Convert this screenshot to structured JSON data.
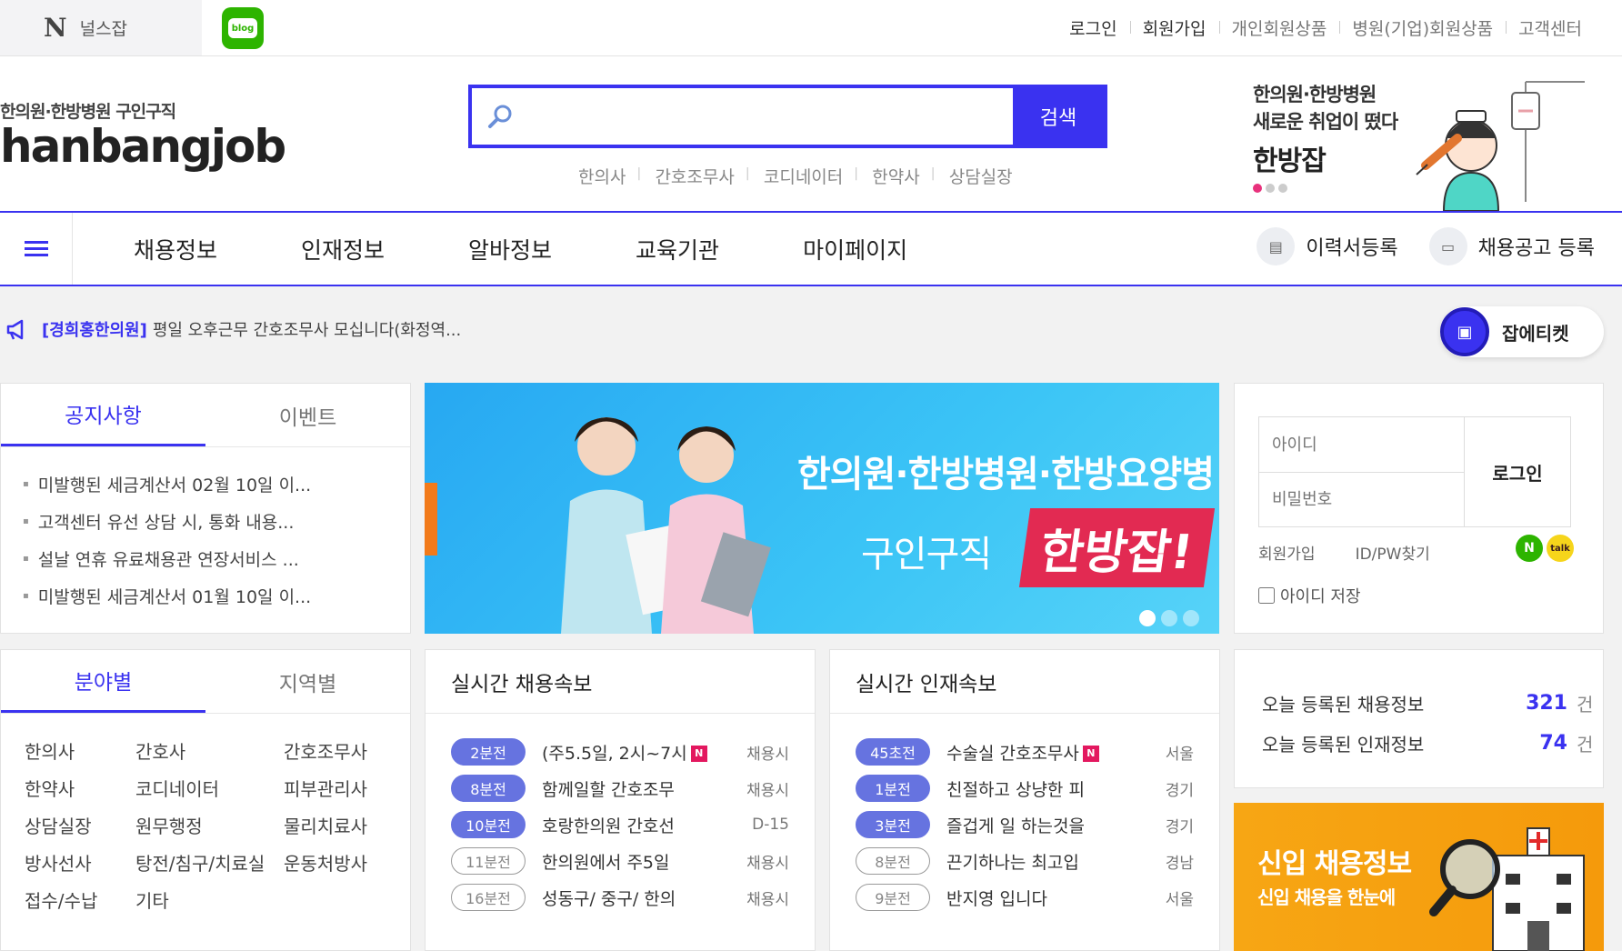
{
  "topbar": {
    "family_name": "널스잡",
    "family_logo": "N",
    "blog_label": "blog",
    "links": [
      {
        "label": "로그인",
        "style": "dark"
      },
      {
        "label": "회원가입",
        "style": "dark"
      },
      {
        "label": "개인회원상품",
        "style": "light"
      },
      {
        "label": "병원(기업)회원상품",
        "style": "light"
      },
      {
        "label": "고객센터",
        "style": "light"
      }
    ]
  },
  "header": {
    "logo_sub": "한의원·한방병원 구인구직",
    "logo_main": "hanbangjob",
    "search": {
      "placeholder": "",
      "button_label": "검색"
    },
    "keywords": [
      "한의사",
      "간호조무사",
      "코디네이터",
      "한약사",
      "상담실장"
    ],
    "promo": {
      "line1": "한의원·한방병원",
      "line2": "새로운 취업이 떴다",
      "line3": "한방잡"
    }
  },
  "nav": {
    "menu": [
      "채용정보",
      "인재정보",
      "알바정보",
      "교육기관",
      "마이페이지"
    ],
    "resume_button": "이력서등록",
    "job_post_button": "채용공고 등록"
  },
  "ticker": {
    "tag": "[경희홍한의원]",
    "message": "평일 오후근무 간호조무사 모십니다(화정역..."
  },
  "etiquette_label": "잡에티켓",
  "notice": {
    "tabs": [
      "공지사항",
      "이벤트"
    ],
    "items": [
      "미발행된 세금계산서 02월 10일 이...",
      "고객센터 유선 상담 시, 통화 내용...",
      "설날 연휴 유료채용관 연장서비스 ...",
      "미발행된 세금계산서 01월 10일 이..."
    ]
  },
  "banner": {
    "line1": "한의원·한방병원·한방요양병",
    "line2": "구인구직",
    "line3": "한방잡!"
  },
  "login": {
    "id_placeholder": "아이디",
    "pw_placeholder": "비밀번호",
    "button": "로그인",
    "signup": "회원가입",
    "find": "ID/PW찾기",
    "save_id": "아이디 저장",
    "naver": "N",
    "kakao": "talk"
  },
  "fields": {
    "tabs": [
      "분야별",
      "지역별"
    ],
    "items": [
      "한의사",
      "간호사",
      "간호조무사",
      "한약사",
      "코디네이터",
      "피부관리사",
      "상담실장",
      "원무행정",
      "물리치료사",
      "방사선사",
      "탕전/침구/치료실",
      "운동처방사",
      "접수/수납",
      "기타"
    ]
  },
  "realtime_jobs": {
    "title": "실시간 채용속보",
    "rows": [
      {
        "time": "2분전",
        "hot": true,
        "title": "(주5.5일, 2시~7시",
        "new": true,
        "meta": "채용시"
      },
      {
        "time": "8분전",
        "hot": true,
        "title": "함께일할 간호조무",
        "new": false,
        "meta": "채용시"
      },
      {
        "time": "10분전",
        "hot": true,
        "title": "호랑한의원 간호선",
        "new": false,
        "meta": "D-15"
      },
      {
        "time": "11분전",
        "hot": false,
        "title": "한의원에서 주5일",
        "new": false,
        "meta": "채용시"
      },
      {
        "time": "16분전",
        "hot": false,
        "title": "성동구/ 중구/ 한의",
        "new": false,
        "meta": "채용시"
      }
    ]
  },
  "realtime_talent": {
    "title": "실시간 인재속보",
    "rows": [
      {
        "time": "45초전",
        "hot": true,
        "title": "수술실 간호조무사",
        "new": true,
        "meta": "서울"
      },
      {
        "time": "1분전",
        "hot": true,
        "title": "친절하고 상냥한 피",
        "new": false,
        "meta": "경기"
      },
      {
        "time": "3분전",
        "hot": true,
        "title": "즐겁게 일 하는것을",
        "new": false,
        "meta": "경기"
      },
      {
        "time": "8분전",
        "hot": false,
        "title": "끈기하나는 최고입",
        "new": false,
        "meta": "경남"
      },
      {
        "time": "9분전",
        "hot": false,
        "title": "반지영 입니다",
        "new": false,
        "meta": "서울"
      }
    ]
  },
  "new_badge": "N",
  "stats": {
    "jobs_label": "오늘 등록된 채용정보",
    "jobs_count": "321",
    "talent_label": "오늘 등록된 인재정보",
    "talent_count": "74",
    "unit": "건"
  },
  "new_jobs_banner": {
    "title": "신입 채용정보",
    "subtitle": "신입 채용을 한눈에"
  },
  "colors": {
    "accent": "#3a32f0",
    "hot_badge": "#6673e0",
    "new_badge": "#e3185f",
    "naver": "#2db400",
    "kakao": "#f6d51b",
    "banner_orange": "#f7a614"
  }
}
